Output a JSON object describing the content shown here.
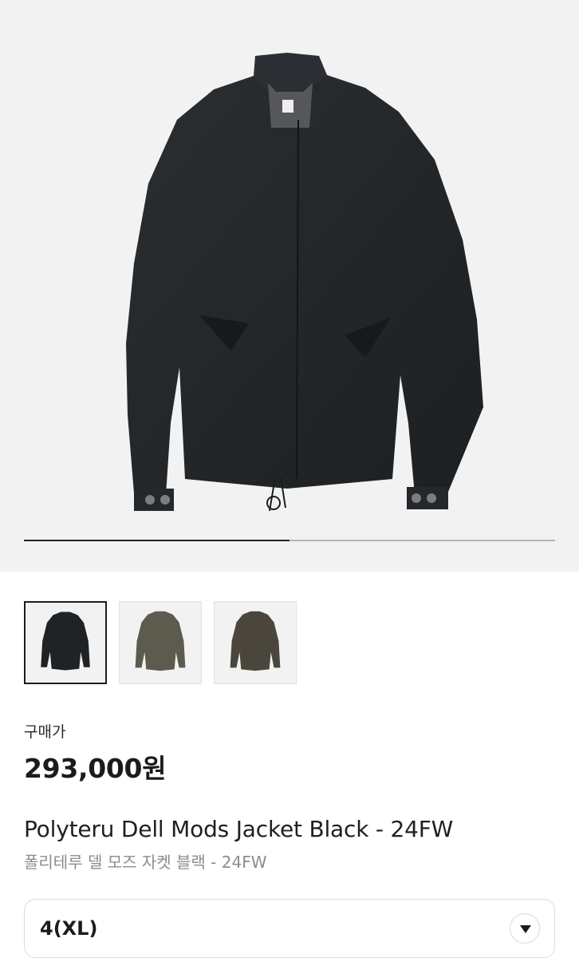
{
  "gallery": {
    "main_image": "jacket-black-front",
    "current_index": 1,
    "total_images": 2,
    "progress": 0.5,
    "thumbnails": [
      {
        "name": "jacket-black",
        "color": "#202325",
        "active": true
      },
      {
        "name": "jacket-khaki",
        "color": "#5d5a4e",
        "active": false
      },
      {
        "name": "jacket-olive-brown",
        "color": "#4a463b",
        "active": false
      }
    ]
  },
  "product": {
    "price_label": "구매가",
    "price": "293,000원",
    "title_en": "Polyteru Dell Mods Jacket Black - 24FW",
    "title_ko": "폴리테루 델 모즈 자켓 블랙 - 24FW"
  },
  "size_select": {
    "selected": "4(XL)",
    "icon": "chevron-down-icon"
  },
  "colors": {
    "jacket_main": "#23272a",
    "background": "#f2f2f2",
    "progress_fill": "#222222",
    "progress_track": "#b5b5b5"
  }
}
